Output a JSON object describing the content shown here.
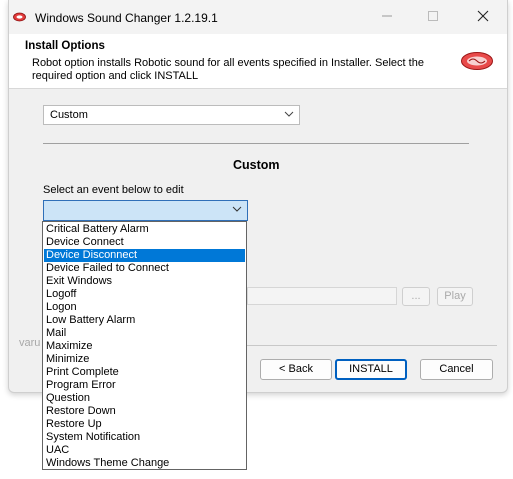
{
  "window": {
    "title": "Windows Sound Changer 1.2.19.1"
  },
  "header": {
    "title": "Install Options",
    "description": "Robot option installs Robotic sound for all events specified in Installer. Select the required option and click INSTALL"
  },
  "options_select": {
    "value": "Custom"
  },
  "section": {
    "title": "Custom",
    "event_label": "Select an event below to edit"
  },
  "event_select": {
    "value": ""
  },
  "browse_button": {
    "label": "..."
  },
  "play_button": {
    "label": "Play"
  },
  "footer": {
    "brand_text": "varu",
    "back_label": "< Back",
    "install_label": "INSTALL",
    "cancel_label": "Cancel"
  },
  "dropdown": {
    "selected_index": 2,
    "items": [
      "Critical Battery Alarm",
      "Device Connect",
      "Device Disconnect",
      "Device Failed to Connect",
      "Exit Windows",
      "Logoff",
      "Logon",
      "Low Battery Alarm",
      "Mail",
      "Maximize",
      "Minimize",
      "Print Complete",
      "Program Error",
      "Question",
      "Restore Down",
      "Restore Up",
      "System Notification",
      "UAC",
      "Windows Theme Change"
    ]
  },
  "colors": {
    "selection": "#0078d7",
    "primary_border": "#0060c0"
  }
}
